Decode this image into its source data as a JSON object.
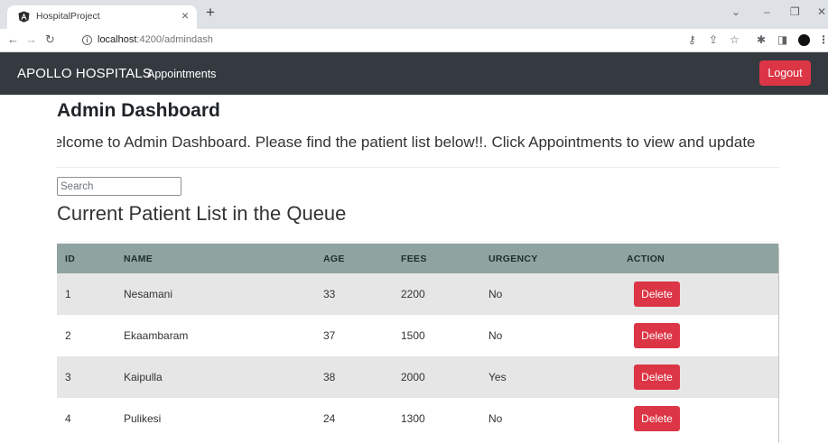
{
  "browser": {
    "tab_title": "HospitalProject",
    "new_tab": "+",
    "url_host": "localhost",
    "url_path": ":4200/admindash"
  },
  "navbar": {
    "brand": "APOLLO HOSPITALS",
    "appointments_link": "Appointments",
    "logout_label": "Logout"
  },
  "dashboard": {
    "title": "Admin Dashboard",
    "welcome": "/elcome to Admin Dashboard. Please find the patient list below!!. Click Appointments to view and update",
    "search_placeholder": "Search",
    "list_heading": "Current Patient List in the Queue"
  },
  "table": {
    "headers": {
      "id": "ID",
      "name": "NAME",
      "age": "AGE",
      "fees": "FEES",
      "urgency": "URGENCY",
      "action": "ACTION"
    },
    "rows": [
      {
        "id": "1",
        "name": "Nesamani",
        "age": "33",
        "fees": "2200",
        "urgency": "No",
        "action": "Delete"
      },
      {
        "id": "2",
        "name": "Ekaambaram",
        "age": "37",
        "fees": "1500",
        "urgency": "No",
        "action": "Delete"
      },
      {
        "id": "3",
        "name": "Kaipulla",
        "age": "38",
        "fees": "2000",
        "urgency": "Yes",
        "action": "Delete"
      },
      {
        "id": "4",
        "name": "Pulikesi",
        "age": "24",
        "fees": "1300",
        "urgency": "No",
        "action": "Delete"
      }
    ]
  },
  "colors": {
    "navbar_bg": "#343a40",
    "danger": "#dc3545",
    "table_header_bg": "#8fa3a0",
    "row_stripe": "#e6e6e6"
  },
  "icons": [
    "angular-icon",
    "close-icon",
    "back-icon",
    "forward-icon",
    "reload-icon",
    "info-icon",
    "key-icon",
    "share-icon",
    "star-icon",
    "extensions-icon",
    "sidepanel-icon",
    "avatar",
    "menu-icon"
  ]
}
